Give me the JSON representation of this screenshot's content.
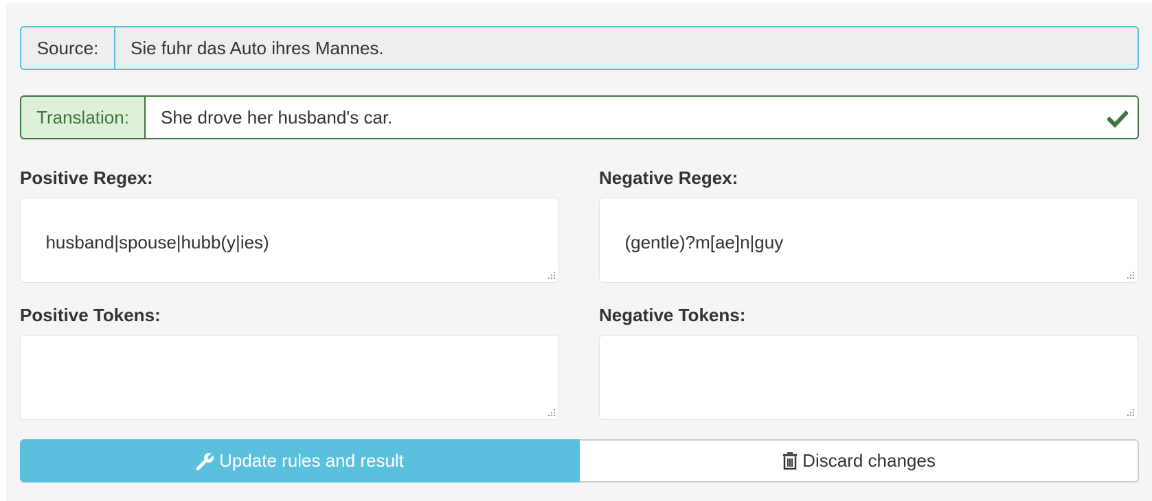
{
  "source": {
    "label": "Source:",
    "text": "Sie fuhr das Auto ihres Mannes."
  },
  "translation": {
    "label": "Translation:",
    "text": "She drove her husband's car.",
    "status_icon": "check-icon"
  },
  "positive_regex": {
    "label": "Positive Regex:",
    "value": "husband|spouse|hubb(y|ies)"
  },
  "negative_regex": {
    "label": "Negative Regex:",
    "value": "(gentle)?m[ae]n|guy"
  },
  "positive_tokens": {
    "label": "Positive Tokens:",
    "value": ""
  },
  "negative_tokens": {
    "label": "Negative Tokens:",
    "value": ""
  },
  "buttons": {
    "update": {
      "label": "Update rules and result",
      "icon": "wrench-icon"
    },
    "discard": {
      "label": "Discard changes",
      "icon": "trash-icon"
    }
  },
  "colors": {
    "info": "#5bc0de",
    "success": "#3c763d",
    "success_bg": "#dff0d8"
  }
}
